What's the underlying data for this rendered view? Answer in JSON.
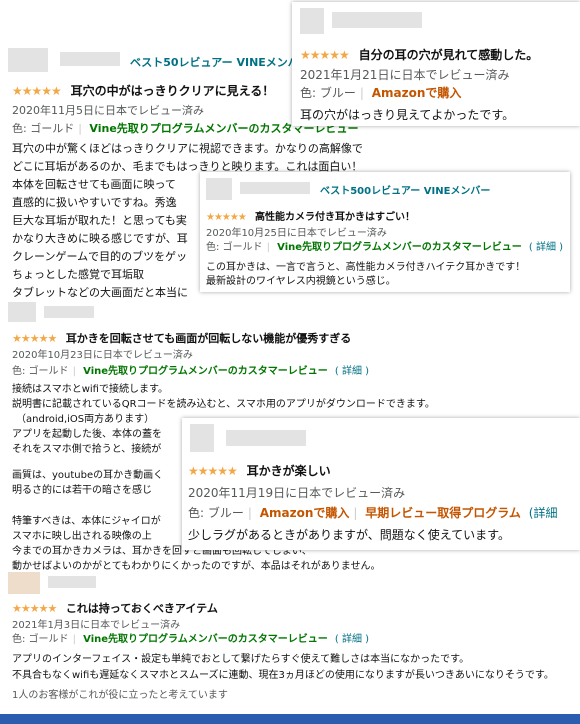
{
  "reviews": {
    "r1": {
      "badge": "ベスト50レビュアー VINEメンバー",
      "stars": "★★★★★",
      "title": "耳穴の中がはっきりクリアに見える！",
      "date": "2020年11月5日に日本でレビュー済み",
      "color": "色: ゴールド",
      "program": "Vine先取りプログラムメンバーのカスタマーレビュー",
      "body": [
        "耳穴の中が驚くほどはっきりクリアに視認できます。かなりの高解像で",
        "どこに耳垢があるのか、毛までもはっきりと映ります。これは面白い！",
        "本体を回転させても画面に映って",
        "直感的に扱いやすいですね。秀逸",
        "巨大な耳垢が取れた！と思っても実",
        "かなり大きめに映る感じですが、耳",
        "クレーンゲームで目的のブツをゲッ",
        "ちょっとした感覚で耳垢取",
        "タブレットなどの大画面だと本当に"
      ]
    },
    "r2": {
      "stars": "★★★★★",
      "title": "自分の耳の穴が見れて感動した。",
      "date": "2021年1月21日に日本でレビュー済み",
      "color": "色: ブルー",
      "purchase": "Amazonで購入",
      "body": "耳の穴がはっきり見えてよかったです。"
    },
    "r3": {
      "badge": "ベスト500レビュアー VINEメンバー",
      "stars": "★★★★★",
      "title": "高性能カメラ付き耳かきはすごい！",
      "date": "2020年10月25日に日本でレビュー済み",
      "color": "色: ゴールド",
      "program": "Vine先取りプログラムメンバーのカスタマーレビュー",
      "details": "( 詳細 )",
      "body": [
        "この耳かきは、一言で言うと、高性能カメラ付きハイテク耳かきです！",
        "最新設計のワイヤレス内視鏡という感じ。"
      ]
    },
    "r4": {
      "stars": "★★★★★",
      "title": "耳かきを回転させても画面が回転しない機能が優秀すぎる",
      "date": "2020年10月23日に日本でレビュー済み",
      "color": "色: ゴールド",
      "program": "Vine先取りプログラムメンバーのカスタマーレビュー",
      "details": "( 詳細 )",
      "body": [
        "接続はスマホとwifiで接続します。",
        "説明書に記載されているQRコードを読み込むと、スマホ用のアプリがダウンロードできます。",
        "（android,iOS両方あります）",
        "アプリを起動した後、本体の蓋を",
        "それをスマホ側で拾うと、接続が",
        "画質は、youtubeの耳かき動画く",
        "明るさ的には若干の暗さを感じ",
        "特筆すべきは、本体にジャイロが",
        "スマホに映し出される映像の上",
        "今までの耳かきカメラは、耳かきを回すと画面も回転してしまい、",
        "動かせばよいのかがとてもわかりにくかったのですが、本品はそれがありません。"
      ]
    },
    "r5": {
      "stars": "★★★★★",
      "title": "耳かきが楽しい",
      "date": "2020年11月19日に日本でレビュー済み",
      "color": "色: ブルー",
      "purchase": "Amazonで購入",
      "program": "早期レビュー取得プログラム",
      "details": "(詳細",
      "body": "少しラグがあるときがありますが、問題なく使えています。"
    },
    "r6": {
      "stars": "★★★★★",
      "title": "これは持っておくべきアイテム",
      "date": "2021年1月3日に日本でレビュー済み",
      "color": "色: ゴールド",
      "program": "Vine先取りプログラムメンバーのカスタマーレビュー",
      "details": "( 詳細 )",
      "body": [
        "アプリのインターフェイス・設定も単純でおとして繋げたらすぐ使えて難しさは本当になかったです。",
        "不具合もなくwifiも遅延なくスマホとスムーズに連動、現在3ヵ月ほどの使用になりますが長いつきあいになりそうです。"
      ],
      "helpful": "1人のお客様がこれが役に立ったと考えています"
    }
  },
  "colors": {
    "link": "#007185",
    "vine": "#007600",
    "orange": "#c45500",
    "star": "#f3a847",
    "bar": "#2a5db0"
  }
}
